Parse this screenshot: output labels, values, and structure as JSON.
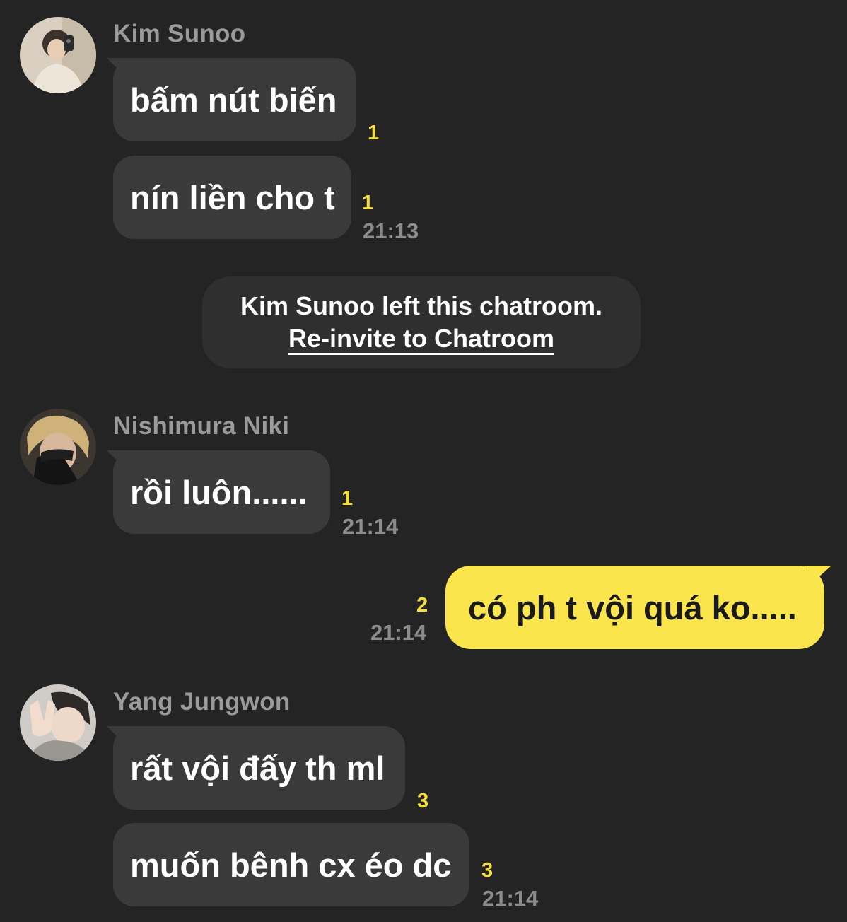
{
  "messages": {
    "sunoo": {
      "name": "Kim Sunoo",
      "bubble1": "bấm nút biến",
      "count1": "1",
      "bubble2": "nín liền cho t",
      "count2": "1",
      "time": "21:13"
    },
    "notice": {
      "text": "Kim Sunoo left this chatroom.",
      "link": "Re-invite to Chatroom"
    },
    "niki": {
      "name": "Nishimura Niki",
      "bubble1": "rồi luôn......",
      "count1": "1",
      "time": "21:14"
    },
    "me": {
      "bubble1": "có ph t vội quá ko.....",
      "count1": "2",
      "time": "21:14"
    },
    "jungwon": {
      "name": "Yang Jungwon",
      "bubble1": "rất vội đấy th ml",
      "count1": "3",
      "bubble2": "muốn bênh cx éo dc",
      "count2": "3",
      "time": "21:14"
    }
  },
  "colors": {
    "background": "#242424",
    "bubble_other": "#3a3a3a",
    "bubble_mine": "#fae64c",
    "unread_count": "#f5de3b",
    "timestamp": "#8c8c8c"
  },
  "icons": {
    "avatar_sunoo": "avatar-photo",
    "avatar_niki": "avatar-photo",
    "avatar_jungwon": "avatar-photo"
  }
}
